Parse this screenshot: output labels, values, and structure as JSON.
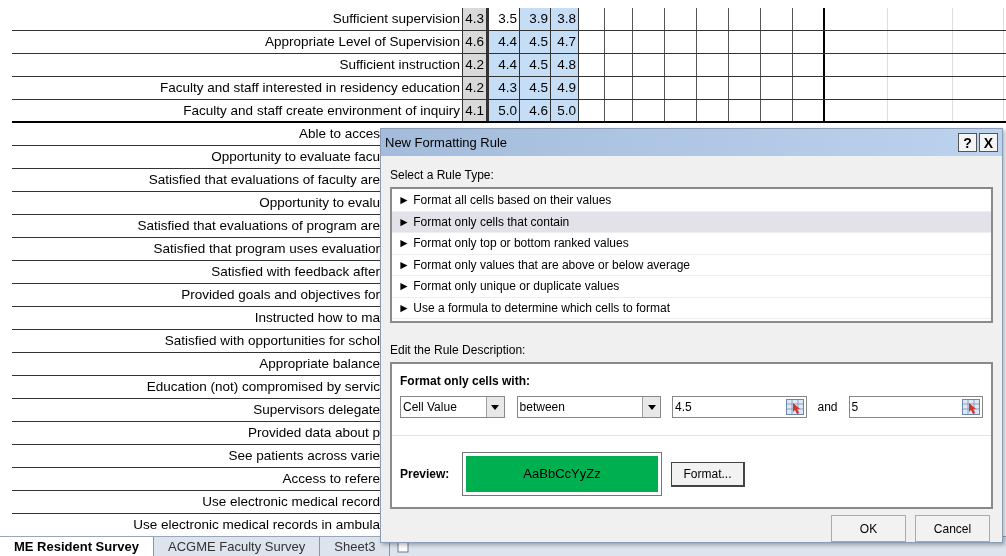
{
  "sheet": {
    "top_rows": [
      {
        "label": "Sufficient supervision",
        "values": [
          {
            "text": "4.3",
            "selected": false
          },
          {
            "text": "3.5",
            "selected": false
          },
          {
            "text": "3.9",
            "selected": true
          },
          {
            "text": "3.8",
            "selected": true
          }
        ]
      },
      {
        "label": "Appropriate Level of Supervision",
        "values": [
          {
            "text": "4.6",
            "selected": false
          },
          {
            "text": "4.4",
            "selected": true
          },
          {
            "text": "4.5",
            "selected": true
          },
          {
            "text": "4.7",
            "selected": true
          }
        ]
      },
      {
        "label": "Sufficient instruction",
        "values": [
          {
            "text": "4.2",
            "selected": false
          },
          {
            "text": "4.4",
            "selected": true
          },
          {
            "text": "4.5",
            "selected": true
          },
          {
            "text": "4.8",
            "selected": true
          }
        ]
      },
      {
        "label": "Faculty and staff interested in residency education",
        "values": [
          {
            "text": "4.2",
            "selected": false
          },
          {
            "text": "4.3",
            "selected": true
          },
          {
            "text": "4.5",
            "selected": true
          },
          {
            "text": "4.9",
            "selected": true
          }
        ]
      },
      {
        "label": "Faculty and staff create environment of inquiry",
        "values": [
          {
            "text": "4.1",
            "selected": false
          },
          {
            "text": "5.0",
            "selected": true
          },
          {
            "text": "4.6",
            "selected": true
          },
          {
            "text": "5.0",
            "selected": true
          }
        ]
      }
    ],
    "lower_rows": [
      "Able to acces",
      "Opportunity to evaluate facu",
      "Satisfied that evaluations of faculty are",
      "Opportunity to evalu",
      "Satisfied that evaluations of program are",
      "Satisfied that program uses evaluatior",
      "Satisfied with feedback after",
      "Provided goals and objectives for",
      "Instructed how to ma",
      "Satisfied with opportunities for schol",
      "Appropriate balance",
      "Education (not) compromised by servic",
      "Supervisors delegate",
      "Provided data about p",
      "See patients across varie",
      "Access to refere",
      "Use electronic medical record",
      "Use electronic medical records in ambula"
    ]
  },
  "sheet_tabs": [
    {
      "label": "ME Resident Survey",
      "selected": true
    },
    {
      "label": "ACGME Faculty Survey",
      "selected": false
    },
    {
      "label": "Sheet3",
      "selected": false
    }
  ],
  "dialog": {
    "title": "New Formatting Rule",
    "help_button": "?",
    "close_button": "X",
    "rule_type_label": "Select a Rule Type:",
    "rule_types": [
      {
        "label": "► Format all cells based on their values",
        "selected": false
      },
      {
        "label": "► Format only cells that contain",
        "selected": true
      },
      {
        "label": "► Format only top or bottom ranked values",
        "selected": false
      },
      {
        "label": "► Format only values that are above or below average",
        "selected": false
      },
      {
        "label": "► Format only unique or duplicate values",
        "selected": false
      },
      {
        "label": "► Use a formula to determine which cells to format",
        "selected": false
      }
    ],
    "description_label": "Edit the Rule Description:",
    "condition_heading": "Format only cells with:",
    "field_dropdown": "Cell Value",
    "operator_dropdown": "between",
    "value_1": "4.5",
    "joiner": "and",
    "value_2": "5",
    "preview_label": "Preview:",
    "preview_text": "AaBbCcYyZz",
    "format_button": "Format...",
    "ok_button": "OK",
    "cancel_button": "Cancel"
  }
}
